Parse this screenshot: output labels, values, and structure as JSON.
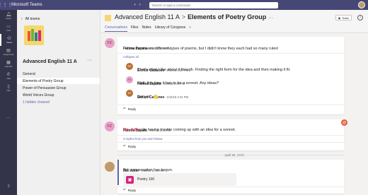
{
  "titlebar": {
    "app_name": "Microsoft Teams",
    "search_placeholder": "Search or type a command"
  },
  "rail": {
    "items": [
      {
        "label": "Activity",
        "icon": "bell-icon"
      },
      {
        "label": "Chat",
        "icon": "chat-icon"
      },
      {
        "label": "Teams",
        "icon": "teams-icon"
      },
      {
        "label": "Assignments",
        "icon": "assignments-icon"
      },
      {
        "label": "Calendar",
        "icon": "calendar-icon"
      },
      {
        "label": "Calls",
        "icon": "phone-icon"
      },
      {
        "label": "Files",
        "icon": "files-icon"
      }
    ]
  },
  "sidebar": {
    "back_label": "All teams",
    "team_name": "Advanced English 11 A",
    "channels": [
      {
        "label": "General"
      },
      {
        "label": "Elements of Poetry Group"
      },
      {
        "label": "Power of Persuasion Group"
      },
      {
        "label": "World Voices Group"
      },
      {
        "label": "1 hidden channel"
      }
    ]
  },
  "header": {
    "team": "Advanced English 11 A",
    "separator": ">",
    "channel": "Elements of Poetry Group",
    "team_button": "Team",
    "tabs": [
      "Conversations",
      "Files",
      "Notes",
      "Library of Congress"
    ]
  },
  "thread1": {
    "author": "Fatima Zapata",
    "initials": "FZ",
    "time": "4/19/18 2:29 PM",
    "text": "I knew there were different types of poems, but I didn't know they each had so many rules!",
    "collapse": "Collapse all",
    "replies": [
      {
        "author": "Enrico Cattaneo",
        "initials": "EC",
        "time": "4/19/18 2:30 PM",
        "text": "That's what I like about it though. Finding the right form for the idea and then making it fit."
      },
      {
        "author": "Fatima Zapata",
        "initials": "FZ",
        "time": "4/19/18 2:30 PM",
        "text": "Well, this time it has to be a sonnet. Any ideas?"
      },
      {
        "author": "Enrico Cattaneo",
        "initials": "EC",
        "time": "4/19/18 2:31 PM",
        "text": "Not yet..."
      }
    ],
    "reply_label": "Reply"
  },
  "thread2": {
    "author": "Fatima Zapata",
    "initials": "FZ",
    "time": "4/19/18 3:33 PM",
    "mention": "Ms. Adler",
    "text": "I'm having trouble coming up with an idea for a sonnet.",
    "replies_summary": "3 replies from you and Fatima",
    "reply_label": "Reply",
    "alert": "@"
  },
  "date_separator": "April 20, 2018",
  "thread3": {
    "author": "Ms. Adler",
    "time": "4/20/18 11:10 AM",
    "text": "Tab conversation has begun.",
    "tab_card_title": "Poetry 100",
    "reply_label": "Reply"
  },
  "colors": {
    "brand": "#464775",
    "accent": "#6264a7",
    "mention": "#c4314b"
  }
}
